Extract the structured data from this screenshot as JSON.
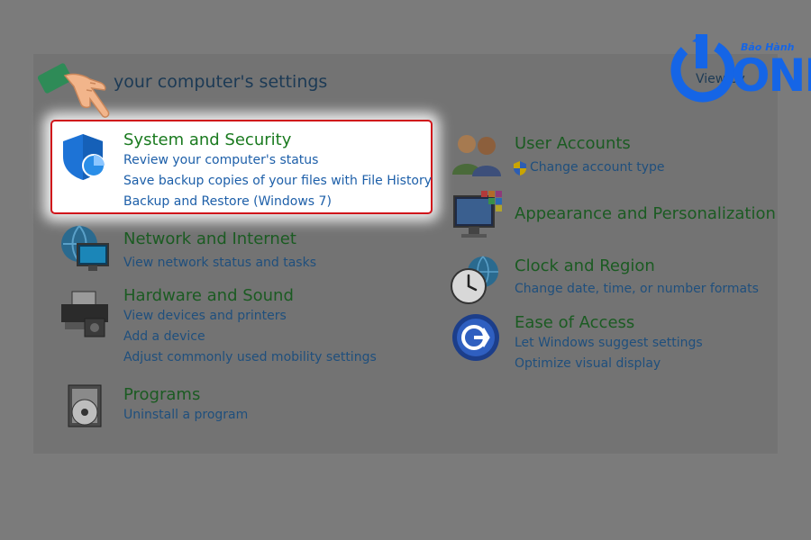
{
  "heading": "your computer's settings",
  "view_by": "View by",
  "logo": {
    "text_top": "Bảo Hành",
    "text_main": "ONE"
  },
  "left_column": [
    {
      "title": "System and Security",
      "links": [
        "Review your computer's status",
        "Save backup copies of your files with File History",
        "Backup and Restore (Windows 7)"
      ],
      "icon": "shield-icon",
      "highlighted": true
    },
    {
      "title": "Network and Internet",
      "links": [
        "View network status and tasks"
      ],
      "icon": "network-globe-icon"
    },
    {
      "title": "Hardware and Sound",
      "links": [
        "View devices and printers",
        "Add a device",
        "Adjust commonly used mobility settings"
      ],
      "icon": "printer-icon"
    },
    {
      "title": "Programs",
      "links": [
        "Uninstall a program"
      ],
      "icon": "programs-disc-icon"
    }
  ],
  "right_column": [
    {
      "title": "User Accounts",
      "links": [
        "Change account type"
      ],
      "icon": "users-icon"
    },
    {
      "title": "Appearance and Personalization",
      "links": [],
      "icon": "monitor-palette-icon"
    },
    {
      "title": "Clock and Region",
      "links": [
        "Change date, time, or number formats"
      ],
      "icon": "clock-globe-icon"
    },
    {
      "title": "Ease of Access",
      "links": [
        "Let Windows suggest settings",
        "Optimize visual display"
      ],
      "icon": "ease-of-access-icon"
    }
  ],
  "colors": {
    "highlight_border": "#d0141b",
    "title_green": "#1a7a1f",
    "link_blue": "#1d5fa9",
    "logo_blue": "#1565e6"
  }
}
